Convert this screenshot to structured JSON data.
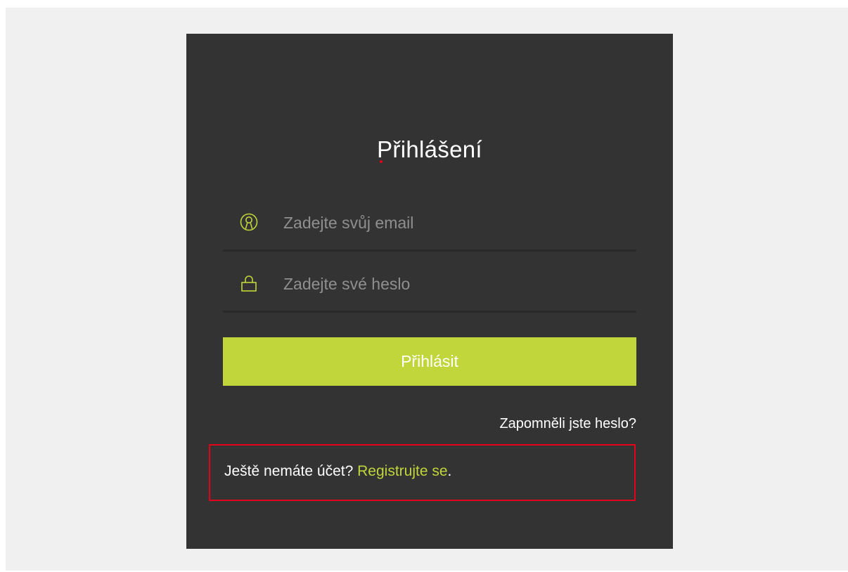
{
  "login": {
    "title": "Přihlášení",
    "email_placeholder": "Zadejte svůj email",
    "password_placeholder": "Zadejte své heslo",
    "submit_label": "Přihlásit",
    "forgot_password": "Zapomněli jste heslo?",
    "register_prompt": "Ještě nemáte účet? ",
    "register_link": "Registrujte se",
    "register_suffix": "."
  },
  "icons": {
    "email": "user-icon",
    "password": "lock-icon"
  },
  "colors": {
    "panel_background": "#333333",
    "page_background": "#f0f0f0",
    "accent": "#c0d63a",
    "highlight": "#e2001a",
    "text": "#ffffff",
    "placeholder": "#8f8f8f"
  }
}
